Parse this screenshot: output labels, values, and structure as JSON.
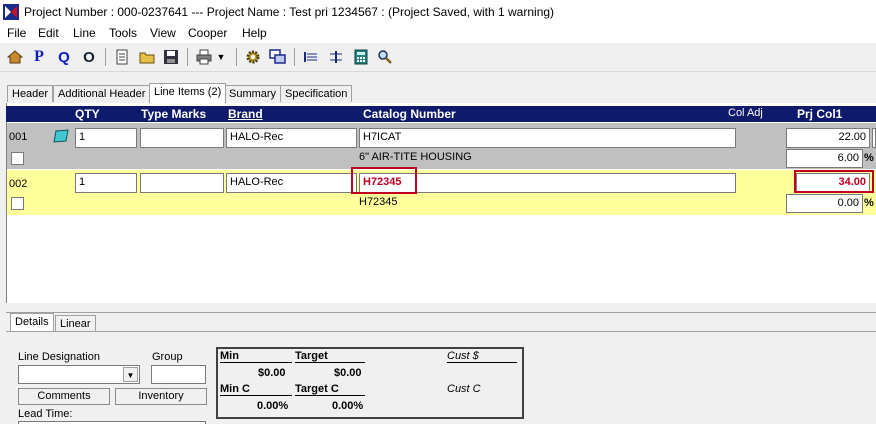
{
  "window": {
    "title": "Project Number : 000-0237641 --- Project Name : Test pri 1234567 : (Project Saved, with 1 warning)"
  },
  "menu": [
    "File",
    "Edit",
    "Line",
    "Tools",
    "View",
    "Cooper",
    "Help"
  ],
  "toolbar": {
    "icons": [
      "home-icon",
      "p-icon",
      "q-icon",
      "o-icon",
      "new-icon",
      "open-folder-icon",
      "save-icon",
      "print-icon",
      "dropdown-icon",
      "gear-icon",
      "windows-icon",
      "split-icon",
      "merge-icon",
      "calculator-icon",
      "search-icon"
    ]
  },
  "tabs": [
    "Header",
    "Additional Header",
    "Line Items (2)",
    "Summary",
    "Specification"
  ],
  "grid": {
    "columns": {
      "qty": "QTY",
      "type_marks": "Type Marks",
      "brand": "Brand",
      "catalog": "Catalog Number",
      "col_adj": "Col Adj",
      "prj_col1": "Prj Col1"
    },
    "rows": [
      {
        "line": "001",
        "qty": "1",
        "type_marks": "",
        "brand": "HALO-Rec",
        "catalog": "H7ICAT",
        "description": "6\" AIR-TITE HOUSING",
        "price": "22.00",
        "pct": "6.00",
        "pct_sign": "%"
      },
      {
        "line": "002",
        "qty": "1",
        "type_marks": "",
        "brand": "HALO-Rec",
        "catalog": "H72345",
        "description": "H72345",
        "price": "34.00",
        "pct": "0.00",
        "pct_sign": "%"
      }
    ]
  },
  "bottom_tabs": [
    "Details",
    "Linear"
  ],
  "details": {
    "line_designation_label": "Line Designation",
    "group_label": "Group",
    "comments_button": "Comments",
    "inventory_button": "Inventory",
    "lead_time_label": "Lead Time:"
  },
  "summary": {
    "min_label": "Min",
    "target_label": "Target",
    "cust_dollar_label": "Cust $",
    "min_value": "$0.00",
    "target_value": "$0.00",
    "min_c_label": "Min C",
    "target_c_label": "Target C",
    "cust_c_label": "Cust C",
    "min_c_value": "0.00%",
    "target_c_value": "0.00%"
  },
  "colors": {
    "header_bg": "#0e1a6b",
    "row1_bg": "#c0c0c0",
    "row2_bg": "#ffff9c",
    "highlight": "#c00020"
  }
}
